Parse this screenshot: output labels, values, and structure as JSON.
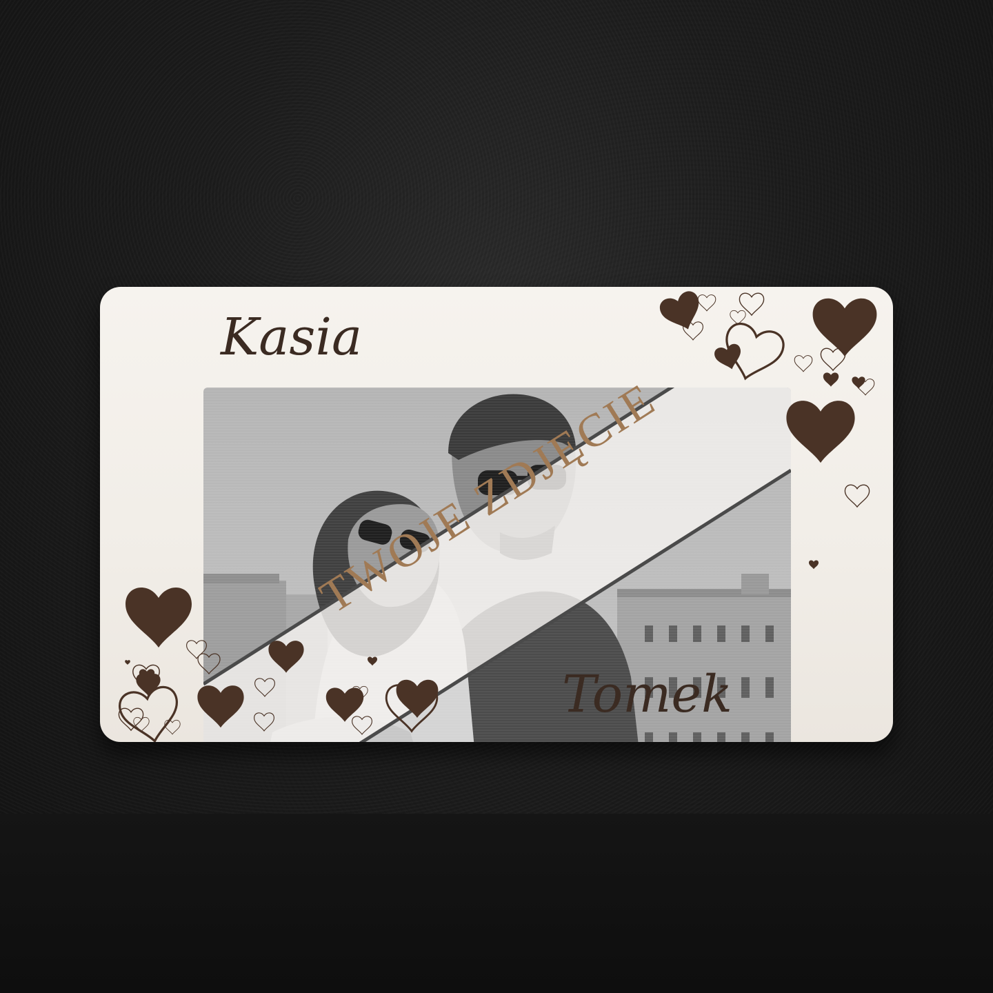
{
  "frame": {
    "name_top": "Kasia",
    "name_bottom": "Tomek",
    "watermark": "TWOJE ZDJĘCIE"
  },
  "colors": {
    "background": "#1a1a1a",
    "frame": "#f3efe9",
    "engraving": "#4a3326",
    "watermark_text": "#a07a55"
  }
}
